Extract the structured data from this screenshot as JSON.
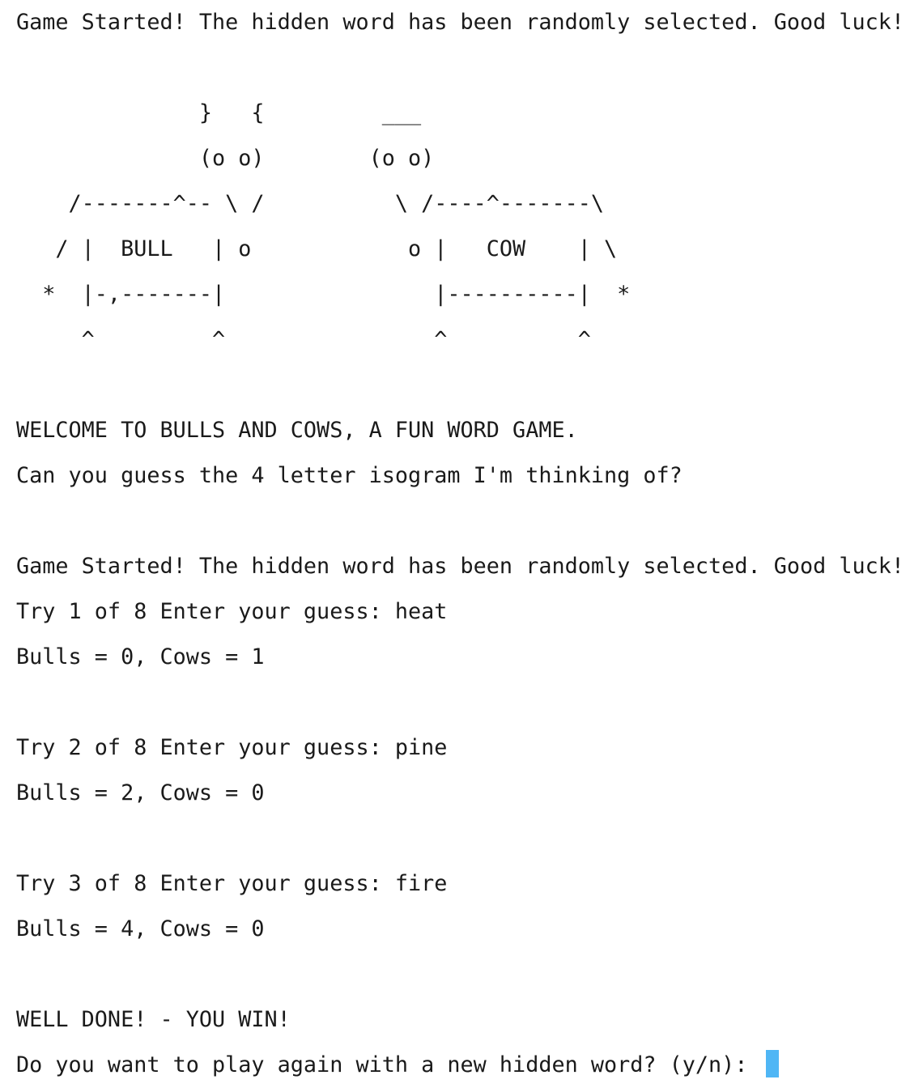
{
  "terminal": {
    "lines": [
      "Game Started! The hidden word has been randomly selected. Good luck!",
      "",
      "              }   {         ___",
      "              (o o)        (o o)",
      "    /-------^-- \\ /          \\ /----^-------\\",
      "   / |  BULL   | o            o |   COW    | \\",
      "  *  |-,-------|                |----------|  *",
      "     ^         ^                ^          ^",
      "",
      "WELCOME TO BULLS AND COWS, A FUN WORD GAME.",
      "Can you guess the 4 letter isogram I'm thinking of?",
      "",
      "Game Started! The hidden word has been randomly selected. Good luck!",
      "Try 1 of 8 Enter your guess: heat",
      "Bulls = 0, Cows = 1",
      "",
      "Try 2 of 8 Enter your guess: pine",
      "Bulls = 2, Cows = 0",
      "",
      "Try 3 of 8 Enter your guess: fire",
      "Bulls = 4, Cows = 0",
      "",
      "WELL DONE! - YOU WIN!",
      "Do you want to play again with a new hidden word? (y/n): "
    ],
    "cursor_color": "#4fb6f5",
    "text_color": "#1a1a1a",
    "background_color": "#ffffff"
  }
}
